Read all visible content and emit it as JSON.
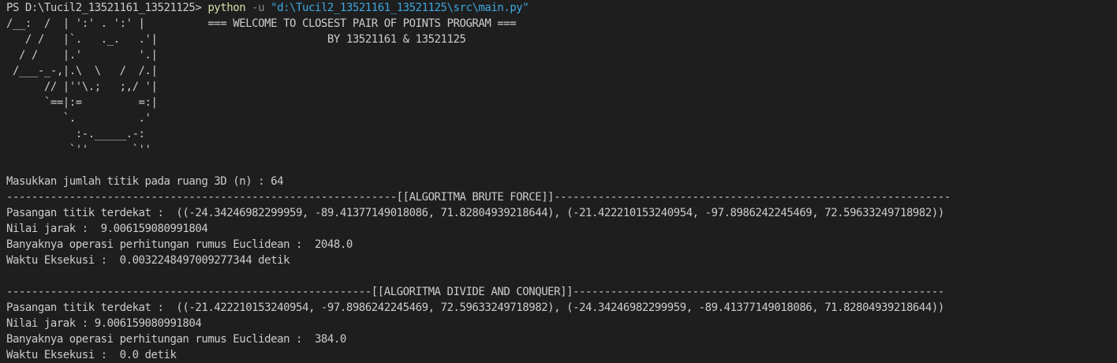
{
  "terminal": {
    "prompt_line": {
      "prompt": "PS D:\\Tucil2_13521161_13521125> ",
      "command": "python",
      "flag": " -u ",
      "path": "\"d:\\Tucil2_13521161_13521125\\src\\main.py\""
    },
    "output_lines": [
      "/__:  /  | ':' . ':' |          === WELCOME TO CLOSEST PAIR OF POINTS PROGRAM ===",
      "   / /   |`.   ._.   .'|                           BY 13521161 & 13521125",
      "  / /    |.'         '.|",
      " /___-_-,|.\\  \\   /  /.|",
      "      // |''\\.;   ;,/ '|",
      "      `==|:=         =:|",
      "         `.          .'",
      "           :-._____.-:",
      "          `''       `''",
      "",
      "Masukkan jumlah titik pada ruang 3D (n) : 64",
      "--------------------------------------------------------------[[ALGORITMA BRUTE FORCE]]---------------------------------------------------------------",
      "Pasangan titik terdekat :  ((-24.34246982299959, -89.41377149018086, 71.82804939218644), (-21.422210153240954, -97.8986242245469, 72.59633249718982))",
      "Nilai jarak :  9.006159080991804",
      "Banyaknya operasi perhitungan rumus Euclidean :  2048.0",
      "Waktu Eksekusi :  0.0032248497009277344 detik",
      "",
      "----------------------------------------------------------[[ALGORITMA DIVIDE AND CONQUER]]-----------------------------------------------------------",
      "Pasangan titik terdekat :  ((-21.422210153240954, -97.8986242245469, 72.59633249718982), (-24.34246982299959, -89.41377149018086, 71.82804939218644))",
      "Nilai jarak : 9.006159080991804",
      "Banyaknya operasi perhitungan rumus Euclidean :  384.0",
      "Waktu Eksekusi :  0.0 detik"
    ]
  }
}
